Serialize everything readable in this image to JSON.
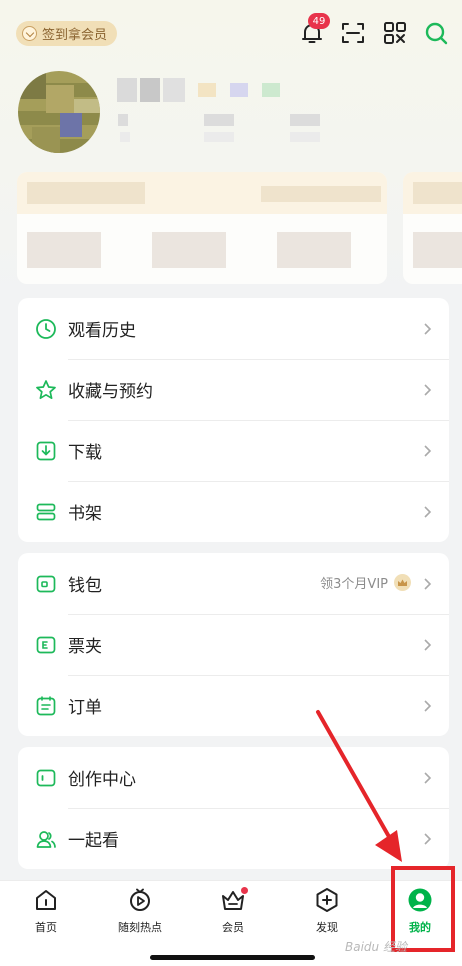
{
  "header": {
    "checkin_label": "签到拿会员",
    "notification_count": "49",
    "icons": [
      "bell-icon",
      "scan-icon",
      "qr-code-icon",
      "search-icon"
    ]
  },
  "menu_group_1": [
    {
      "label": "观看历史",
      "icon": "clock-icon"
    },
    {
      "label": "收藏与预约",
      "icon": "star-icon"
    },
    {
      "label": "下载",
      "icon": "download-icon"
    },
    {
      "label": "书架",
      "icon": "bookshelf-icon"
    }
  ],
  "menu_group_2": [
    {
      "label": "钱包",
      "icon": "wallet-icon",
      "extra": "领3个月VIP"
    },
    {
      "label": "票夹",
      "icon": "ticket-icon"
    },
    {
      "label": "订单",
      "icon": "order-icon"
    }
  ],
  "menu_group_3": [
    {
      "label": "创作中心",
      "icon": "creator-icon"
    },
    {
      "label": "一起看",
      "icon": "watch-together-icon"
    }
  ],
  "tabbar": {
    "tabs": [
      {
        "label": "首页",
        "icon": "home-icon"
      },
      {
        "label": "随刻热点",
        "icon": "hot-play-icon"
      },
      {
        "label": "会员",
        "icon": "vip-crown-icon"
      },
      {
        "label": "发现",
        "icon": "discover-icon"
      },
      {
        "label": "我的",
        "icon": "profile-icon"
      }
    ],
    "active": "我的"
  },
  "watermark": "Baidu 经验",
  "colors": {
    "accent": "#00b34a",
    "badge": "#e8344b",
    "highlight": "#e5252a",
    "icon_green": "#1db95a"
  }
}
